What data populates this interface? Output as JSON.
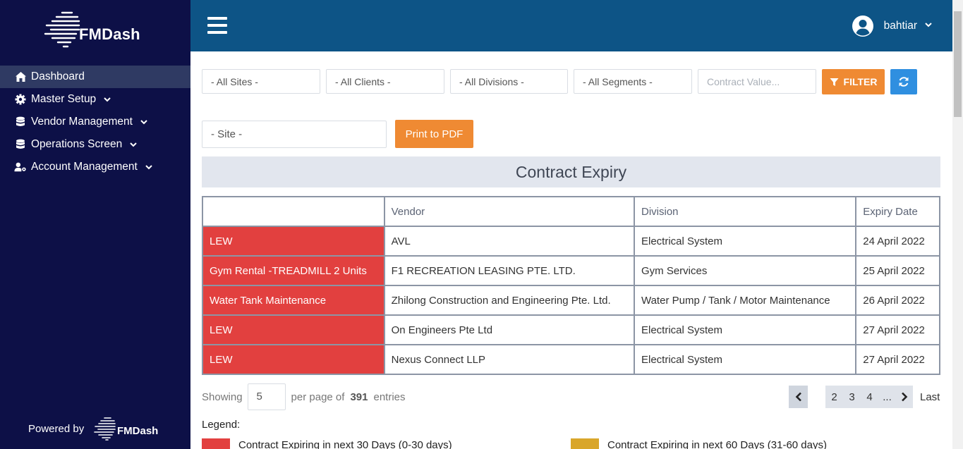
{
  "app": {
    "logo_text": "FMDash"
  },
  "sidebar": {
    "items": [
      {
        "label": "Dashboard",
        "icon": "home-icon",
        "active": true,
        "has_caret": false
      },
      {
        "label": "Master Setup",
        "icon": "gear-icon",
        "active": false,
        "has_caret": true
      },
      {
        "label": "Vendor Management",
        "icon": "database-icon",
        "active": false,
        "has_caret": true
      },
      {
        "label": "Operations Screen",
        "icon": "database-icon",
        "active": false,
        "has_caret": true
      },
      {
        "label": "Account Management",
        "icon": "user-gear-icon",
        "active": false,
        "has_caret": true
      }
    ],
    "powered_by": "Powered by",
    "powered_logo_text": "FMDash"
  },
  "header": {
    "username": "bahtiar"
  },
  "filters": {
    "sites": "- All Sites -",
    "clients": "- All Clients -",
    "divisions": "- All Divisions -",
    "segments": "- All Segments -",
    "contract_value_placeholder": "Contract Value...",
    "filter_label": "FILTER",
    "site": "- Site -",
    "print_label": "Print to PDF"
  },
  "section": {
    "title": "Contract Expiry"
  },
  "table": {
    "headers": [
      "",
      "Vendor",
      "Division",
      "Expiry Date"
    ],
    "rows": [
      [
        "LEW",
        "AVL",
        "Electrical System",
        "24 April 2022"
      ],
      [
        "Gym Rental -TREADMILL 2 Units",
        "F1 RECREATION LEASING PTE. LTD.",
        "Gym Services",
        "25 April 2022"
      ],
      [
        "Water Tank Maintenance",
        "Zhilong Construction and Engineering Pte. Ltd.",
        "Water Pump / Tank / Motor Maintenance",
        "26 April 2022"
      ],
      [
        "LEW",
        "On Engineers Pte Ltd",
        "Electrical System",
        "27 April 2022"
      ],
      [
        "LEW",
        "Nexus Connect LLP",
        "Electrical System",
        "27 April 2022"
      ]
    ]
  },
  "pagination": {
    "showing_label": "Showing",
    "per_page_value": "5",
    "per_page_label": "per page of",
    "total": "391",
    "entries_label": "entries",
    "pages": [
      "2",
      "3",
      "4",
      "..."
    ],
    "last_label": "Last"
  },
  "legend": {
    "title": "Legend:",
    "items": [
      {
        "label": "Contract Expiring in next 30 Days (0-30 days)",
        "color": "#e2403f"
      },
      {
        "label": "Contract Expiring in next 60 Days (31-60 days)",
        "color": "#d9a62b"
      }
    ]
  },
  "colors": {
    "sidebar_bg": "#0d1047",
    "topbar_bg": "#0d5486",
    "accent_orange": "#ef8a33",
    "accent_blue": "#2f8fe0",
    "expiry_red": "#e2403f"
  }
}
